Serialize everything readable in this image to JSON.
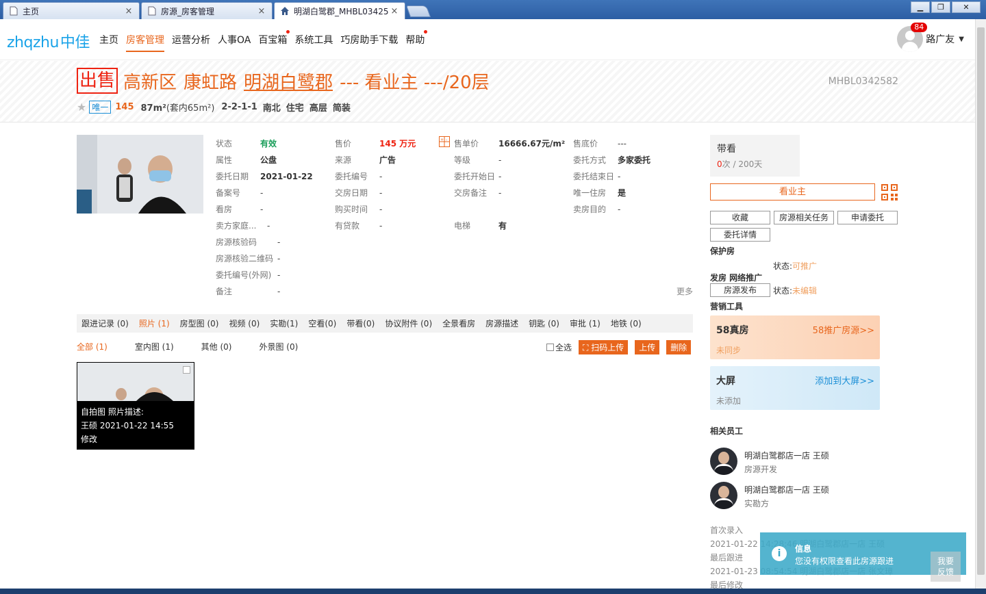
{
  "browser": {
    "tabs": [
      {
        "label": "主页",
        "close": "×"
      },
      {
        "label": "房源_房客管理",
        "close": "×"
      },
      {
        "label": "明湖白鹭郡_MHBL03425",
        "close": "×"
      }
    ],
    "window_buttons": {
      "minimize": "▁",
      "restore": "❐",
      "close": "✕"
    }
  },
  "nav": {
    "logo_text": "zhqzhu",
    "logo_cn": "中佳",
    "items": [
      {
        "label": "主页"
      },
      {
        "label": "房客管理"
      },
      {
        "label": "运营分析"
      },
      {
        "label": "人事OA"
      },
      {
        "label": "百宝箱"
      },
      {
        "label": "系统工具"
      },
      {
        "label": "巧房助手下载"
      },
      {
        "label": "帮助"
      }
    ],
    "badge_count": "84",
    "user_name": "路广友",
    "caret": "▼"
  },
  "header": {
    "sale_tag": "出售",
    "district": "高新区",
    "road": "康虹路",
    "estate": "明湖白鹭郡",
    "rest": "--- 看业主 ---/20层",
    "code": "MHBL0342582",
    "star": "★",
    "only": "唯一",
    "price": "145",
    "area": "87m²",
    "area_inner": "(套内65m²)",
    "layout": "2-2-1-1",
    "orientation": "南北",
    "usage": "住宅",
    "floor_level": "高层",
    "decoration": "简装"
  },
  "info": {
    "col1": [
      {
        "k": "状态",
        "v": "有效"
      },
      {
        "k": "属性",
        "v": "公盘"
      },
      {
        "k": "委托日期",
        "v": "2021-01-22"
      },
      {
        "k": "备案号",
        "v": "-"
      },
      {
        "k": "看房",
        "v": "-"
      },
      {
        "k": "卖方家庭...",
        "v": "-"
      },
      {
        "k": "房源核验码",
        "v": "-"
      },
      {
        "k": "房源核验二维码",
        "v": "-"
      },
      {
        "k": "委托编号(外网)",
        "v": "-"
      },
      {
        "k": "备注",
        "v": "-"
      }
    ],
    "col2": [
      {
        "k": "售价",
        "v": "145 万元"
      },
      {
        "k": "来源",
        "v": "广告"
      },
      {
        "k": "委托编号",
        "v": "-"
      },
      {
        "k": "交房日期",
        "v": "-"
      },
      {
        "k": "购买时间",
        "v": "-"
      },
      {
        "k": "有贷款",
        "v": "-"
      }
    ],
    "col3": [
      {
        "k": "售单价",
        "v": "16666.67元/m²"
      },
      {
        "k": "等级",
        "v": "-"
      },
      {
        "k": "委托开始日",
        "v": "-"
      },
      {
        "k": "交房备注",
        "v": "-"
      }
    ],
    "col4": [
      {
        "k": "售底价",
        "v": "---"
      },
      {
        "k": "委托方式",
        "v": "多家委托"
      },
      {
        "k": "委托结束日",
        "v": "-"
      },
      {
        "k": "唯一住房",
        "v": "是"
      },
      {
        "k": "卖房目的",
        "v": "-"
      }
    ],
    "elevator": {
      "k": "电梯",
      "v": "有"
    },
    "more": "更多"
  },
  "tabs": [
    "跟进记录 (0)",
    "照片 (1)",
    "房型图 (0)",
    "视频 (0)",
    "实勘(1)",
    "空看(0)",
    "带看(0)",
    "协议附件 (0)",
    "全景看房",
    "房源描述",
    "钥匙 (0)",
    "审批 (1)",
    "地铁 (0)"
  ],
  "subtabs": [
    "全部 (1)",
    "室内图 (1)",
    "其他 (0)",
    "外景图 (0)"
  ],
  "actions": {
    "select_all": "全选",
    "scan_upload": "扫码上传",
    "upload": "上传",
    "delete": "删除"
  },
  "photo": {
    "line1": "自拍图   照片描述:",
    "line2": "王硕 2021-01-22 14:55",
    "line3": "修改"
  },
  "right": {
    "daikan_title": "带看",
    "daikan_count_red": "0",
    "daikan_count_rest": "次 / 200天",
    "see_owner": "看业主",
    "btn_fav": "收藏",
    "btn_tasks": "房源相关任务",
    "btn_apply": "申请委托",
    "btn_detail": "委托详情",
    "protect_title": "保护房",
    "protect_status_label": "状态:",
    "protect_status": "可推广",
    "publish_title": "发房 网络推广",
    "publish_btn": "房源发布",
    "publish_status_label": "状态:",
    "publish_status": "未编辑",
    "marketing_title": "营销工具",
    "card58_title": "58真房",
    "card58_link": "58推广房源>>",
    "card58_sub": "未同步",
    "cardbig_title": "大屏",
    "cardbig_link": "添加到大屏>>",
    "cardbig_sub": "未添加",
    "staff_title": "相关员工",
    "staff": [
      {
        "name": "明湖白鹭郡店一店 王硕",
        "role": "房源开发"
      },
      {
        "name": "明湖白鹭郡店一店 王硕",
        "role": "实勘方"
      }
    ],
    "log": [
      "首次录入",
      "2021-01-22 14:28:46 明湖白鹭郡店一店 王硕",
      "最后跟进",
      "2021-01-23 08:54:54 明湖白鹭郡店一店 张文璋",
      "最后修改"
    ]
  },
  "toast": {
    "icon": "i",
    "title": "信息",
    "message": "您没有权限查看此房源跟进"
  },
  "feedback": {
    "line1": "我要",
    "line2": "反馈"
  },
  "colors": {
    "accent": "#e8661d",
    "brand": "#1aa3e8",
    "red": "#e21e1e",
    "green": "#1a9e5a"
  }
}
